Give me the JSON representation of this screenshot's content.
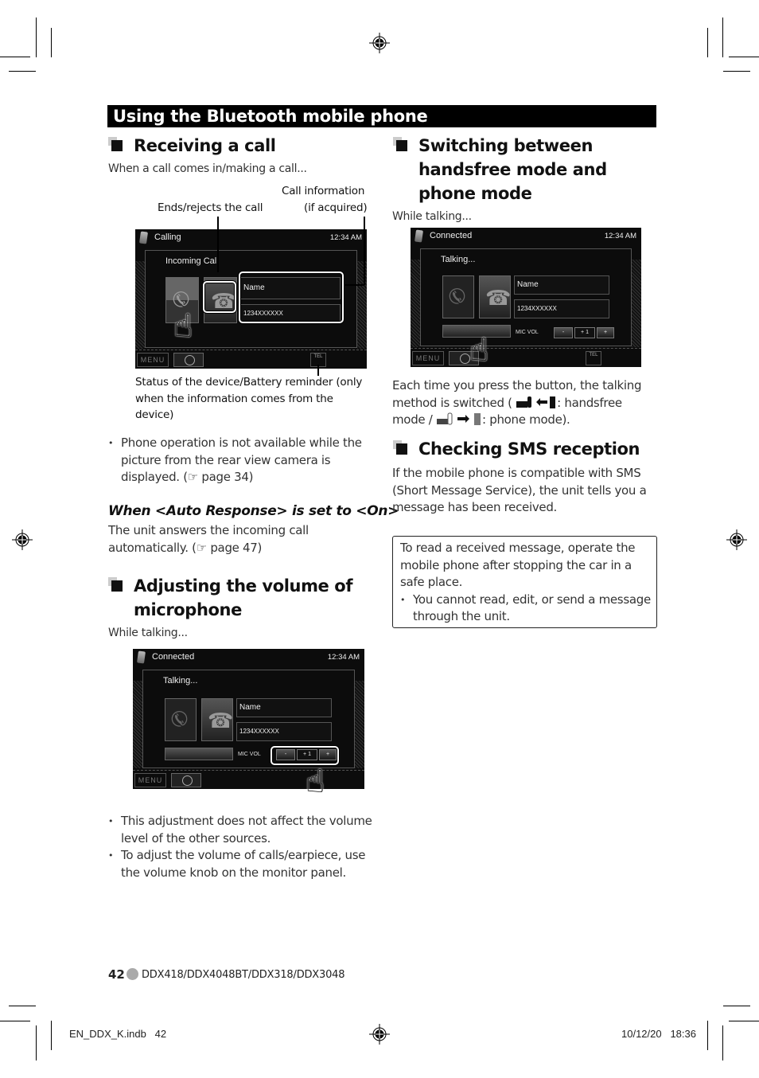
{
  "banner": {
    "title": "Using the Bluetooth mobile phone"
  },
  "receiving": {
    "heading": "Receiving a call",
    "intro": "When a call comes in/making a call...",
    "callout_end": "Ends/rejects the call",
    "callout_info_line1": "Call information",
    "callout_info_line2": "(if acquired)",
    "callout_status": "Status of the device/Battery reminder (only when the information comes from the device)",
    "screen": {
      "title": "Calling",
      "clock": "12:34 AM",
      "subtitle": "Incoming Call",
      "name_field": "Name",
      "number_field": "1234XXXXXX",
      "menu_label": "MENU",
      "tel_label": "TEL"
    },
    "bullets": [
      "Phone operation is not available while the picture from the rear view camera is displayed. (☞ page 34)"
    ],
    "auto_heading": "When <Auto Response> is set to <On>",
    "auto_text": "The unit answers the incoming call automatically. (☞ page 47)"
  },
  "microphone": {
    "heading": "Adjusting the volume of microphone",
    "intro": "While talking...",
    "screen": {
      "title": "Connected",
      "clock": "12:34 AM",
      "subtitle": "Talking...",
      "name_field": "Name",
      "number_field": "1234XXXXXX",
      "mic_vol_label": "MIC VOL",
      "vol_minus": "-",
      "vol_value": "+ 1",
      "vol_plus": "+",
      "menu_label": "MENU"
    },
    "bullets": [
      "This adjustment does not affect the volume level of the other sources.",
      "To adjust the volume of calls/earpiece, use the volume knob on the monitor panel."
    ]
  },
  "switching": {
    "heading": "Switching between handsfree mode and phone mode",
    "intro": "While talking...",
    "screen": {
      "title": "Connected",
      "clock": "12:34 AM",
      "subtitle": "Talking...",
      "name_field": "Name",
      "number_field": "1234XXXXXX",
      "mic_vol_label": "MIC VOL",
      "vol_minus": "-",
      "vol_value": "+ 1",
      "vol_plus": "+",
      "menu_label": "MENU",
      "tel_label": "TEL"
    },
    "text_part1": "Each time you press the button, the talking method is switched (",
    "handsfree_label": ": handsfree mode / ",
    "phone_label": ": phone mode)."
  },
  "sms": {
    "heading": "Checking SMS reception",
    "text": "If the mobile phone is compatible with SMS (Short Message Service), the unit tells you a message has been received.",
    "note_text": "To read a received message, operate the mobile phone after stopping the car in a safe place.",
    "note_bullet": "You cannot read, edit, or send a message through the unit."
  },
  "footer": {
    "page_number": "42",
    "models": "DDX418/DDX4048BT/DDX318/DDX3048",
    "slug_file": "EN_DDX_K.indb   42",
    "slug_date": "10/12/20   18:36"
  }
}
